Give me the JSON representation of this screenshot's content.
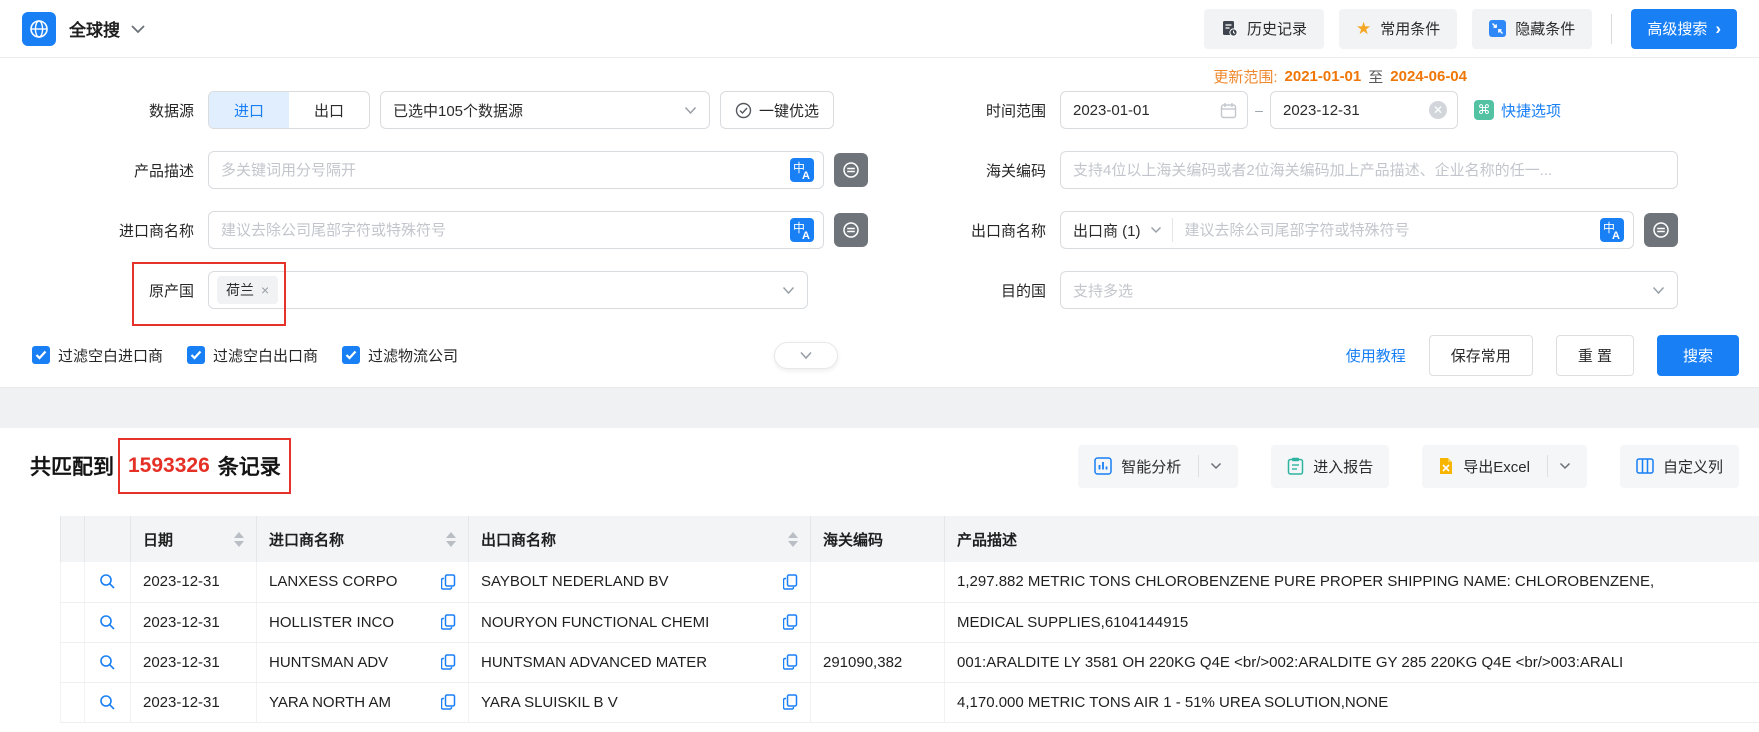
{
  "colors": {
    "primary": "#187ff5",
    "orange_label": "#f0882d",
    "orange_date": "#ee7708",
    "annotation_red": "#e5322a",
    "count_red": "#e53026",
    "teal": "#52c2a3",
    "gold_star": "#f5a623",
    "gray_button": "#6f747a"
  },
  "topbar": {
    "app_title": "全球搜",
    "history_label": "历史记录",
    "favorites_label": "常用条件",
    "hide_label": "隐藏条件",
    "advanced_label": "高级搜索",
    "advanced_arrow": "›",
    "star_glyph": "★"
  },
  "update_range": {
    "label": "更新范围:",
    "start": "2021-01-01",
    "to": "至",
    "end": "2024-06-04"
  },
  "form": {
    "data_source": {
      "label": "数据源",
      "tab_import": "进口",
      "tab_export": "出口",
      "selected_text": "已选中105个数据源",
      "optimize_label": "一键优选"
    },
    "time_range": {
      "label": "时间范围",
      "start": "2023-01-01",
      "separator": "–",
      "end": "2023-12-31",
      "clear_glyph": "✕",
      "quick_label": "快捷选项",
      "cmd_glyph": "⌘"
    },
    "product_desc": {
      "label": "产品描述",
      "placeholder": "多关键词用分号隔开"
    },
    "hs_code": {
      "label": "海关编码",
      "placeholder": "支持4位以上海关编码或者2位海关编码加上产品描述、企业名称的任一..."
    },
    "importer": {
      "label": "进口商名称",
      "placeholder": "建议去除公司尾部字符或特殊符号"
    },
    "exporter": {
      "label": "出口商名称",
      "type_selected": "出口商 (1)",
      "placeholder": "建议去除公司尾部字符或特殊符号"
    },
    "origin": {
      "label": "原产国",
      "tag": "荷兰",
      "tag_close": "×"
    },
    "destination": {
      "label": "目的国",
      "placeholder": "支持多选"
    },
    "translate_icon": {
      "zh": "中",
      "en": "A"
    },
    "filters": [
      {
        "label": "过滤空白进口商",
        "checked": true
      },
      {
        "label": "过滤空白出口商",
        "checked": true
      },
      {
        "label": "过滤物流公司",
        "checked": true
      }
    ],
    "actions": {
      "tutorial": "使用教程",
      "save": "保存常用",
      "reset": "重 置",
      "search": "搜索"
    }
  },
  "results": {
    "prefix": "共匹配到",
    "count": "1593326",
    "suffix": "条记录",
    "actions": {
      "analysis": "智能分析",
      "report": "进入报告",
      "export": "导出Excel",
      "columns": "自定义列"
    }
  },
  "table": {
    "headers": [
      "日期",
      "进口商名称",
      "出口商名称",
      "海关编码",
      "产品描述"
    ],
    "rows": [
      {
        "date": "2023-12-31",
        "importer": "LANXESS CORPO",
        "exporter": "SAYBOLT NEDERLAND BV",
        "hs_code": "",
        "desc": "1,297.882 METRIC TONS CHLOROBENZENE PURE PROPER SHIPPING NAME: CHLOROBENZENE,"
      },
      {
        "date": "2023-12-31",
        "importer": "HOLLISTER INCO",
        "exporter": "NOURYON FUNCTIONAL CHEMI",
        "hs_code": "",
        "desc": "MEDICAL SUPPLIES,6104144915"
      },
      {
        "date": "2023-12-31",
        "importer": "HUNTSMAN ADV",
        "exporter": "HUNTSMAN ADVANCED MATER",
        "hs_code": "291090,382",
        "desc": "001:ARALDITE LY 3581 OH 220KG Q4E <br/>002:ARALDITE GY 285 220KG Q4E <br/>003:ARALI"
      },
      {
        "date": "2023-12-31",
        "importer": "YARA NORTH AM",
        "exporter": "YARA SLUISKIL B V",
        "hs_code": "",
        "desc": "4,170.000 METRIC TONS AIR 1 - 51% UREA SOLUTION,NONE"
      }
    ]
  }
}
